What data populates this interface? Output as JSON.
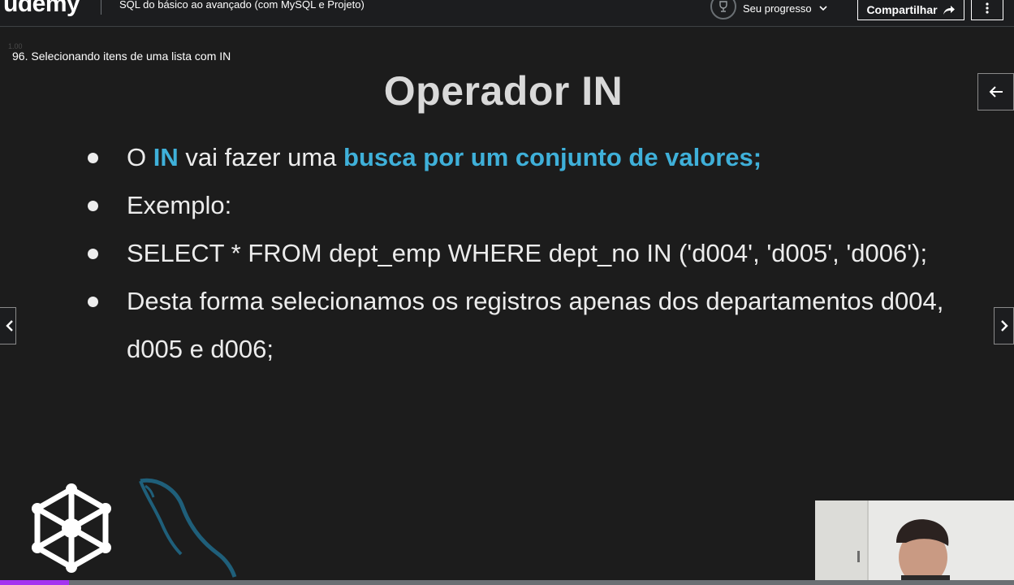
{
  "header": {
    "logo_text": "udemy",
    "course_title": "SQL do básico ao avançado (com MySQL e Projeto)",
    "progress_label": "Seu progresso",
    "share_label": "Compartilhar"
  },
  "video": {
    "ghost_number": "1.00",
    "lecture_label": "96. Selecionando itens de uma lista com IN",
    "slide": {
      "title": "Operador IN",
      "bullet1": {
        "a": "O ",
        "b": "IN",
        "c": " vai fazer uma ",
        "d": "busca por um conjunto de valores;"
      },
      "bullet2": "Exemplo:",
      "bullet3": "SELECT * FROM dept_emp WHERE dept_no IN ('d004', 'd005', 'd006');",
      "bullet4": "Desta forma selecionamos os registros apenas dos departamentos d004, d005 e d006;"
    },
    "progress_fraction": 0.068
  },
  "colors": {
    "accent": "#a435f0",
    "highlight": "#3fb0d9"
  }
}
